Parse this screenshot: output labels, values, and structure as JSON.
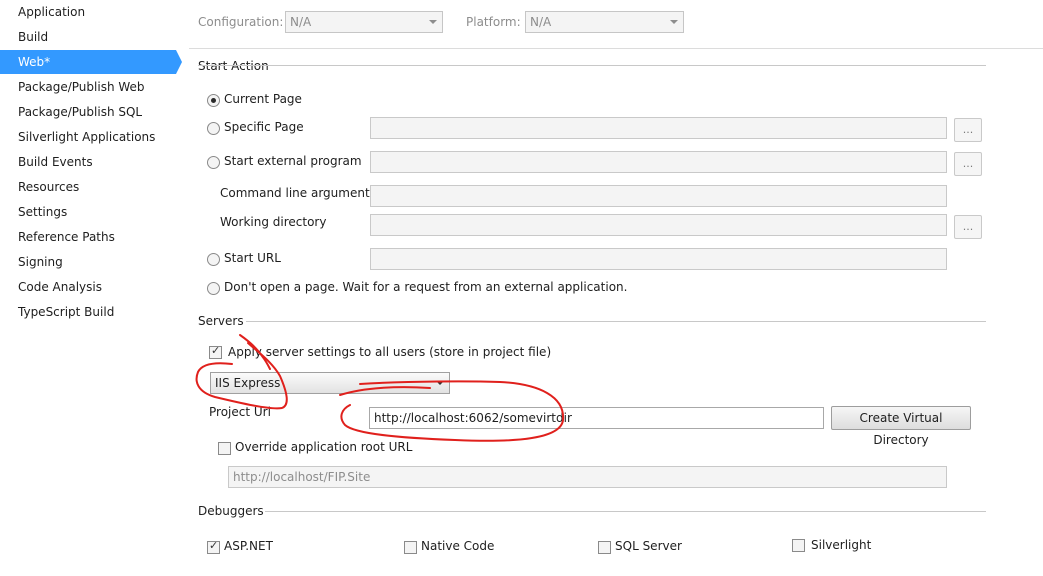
{
  "sidebar": {
    "items": [
      {
        "label": "Application"
      },
      {
        "label": "Build"
      },
      {
        "label": "Web*"
      },
      {
        "label": "Package/Publish Web"
      },
      {
        "label": "Package/Publish SQL"
      },
      {
        "label": "Silverlight Applications"
      },
      {
        "label": "Build Events"
      },
      {
        "label": "Resources"
      },
      {
        "label": "Settings"
      },
      {
        "label": "Reference Paths"
      },
      {
        "label": "Signing"
      },
      {
        "label": "Code Analysis"
      },
      {
        "label": "TypeScript Build"
      }
    ],
    "active_index": 2,
    "active_color": "#3399ff"
  },
  "config_bar": {
    "configuration_label": "Configuration:",
    "configuration_value": "N/A",
    "platform_label": "Platform:",
    "platform_value": "N/A"
  },
  "start_action": {
    "title": "Start Action",
    "current_page": "Current Page",
    "specific_page": "Specific Page",
    "start_external_program": "Start external program",
    "command_line_arguments": "Command line arguments",
    "working_directory": "Working directory",
    "start_url": "Start URL",
    "dont_open": "Don't open a page.  Wait for a request from an external application.",
    "browse_label": "...",
    "selected": "Current Page"
  },
  "servers": {
    "title": "Servers",
    "apply_settings": "Apply server settings to all users (store in project file)",
    "apply_checked": true,
    "server_type": "IIS Express",
    "project_url_label": "Project Url",
    "project_url_value": "http://localhost:6062/somevirtdir",
    "create_vdir_button": "Create Virtual Directory",
    "override_root": "Override application root URL",
    "override_checked": false,
    "override_value": "http://localhost/FIP.Site"
  },
  "debuggers": {
    "title": "Debuggers",
    "aspnet": "ASP.NET",
    "aspnet_checked": true,
    "native_code": "Native Code",
    "sql_server": "SQL Server",
    "silverlight": "Silverlight"
  },
  "annotation_color": "#e0201c"
}
